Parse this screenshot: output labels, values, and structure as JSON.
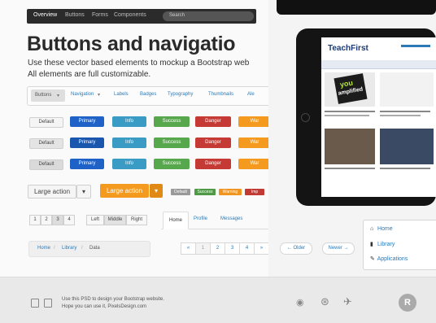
{
  "topnav": {
    "items": [
      "Overview",
      "Buttons",
      "Forms",
      "Components"
    ],
    "search_placeholder": "Search"
  },
  "page_title": "Buttons and navigatio",
  "description": [
    "Use these vector based elements to mockup a Bootstrap web",
    "All elements are full customizable."
  ],
  "tabnav": [
    "Buttons",
    "Navigation",
    "Labels",
    "Badges",
    "Typography",
    "Thumbnails",
    "Ale"
  ],
  "button_rows": [
    [
      "Default",
      "Primary",
      "Info",
      "Success",
      "Danger",
      "War"
    ],
    [
      "Default",
      "Primary",
      "Info",
      "Success",
      "Danger",
      "War"
    ],
    [
      "Default",
      "Primary",
      "Info",
      "Success",
      "Danger",
      "War"
    ]
  ],
  "large_actions": [
    "Large action",
    "Large action"
  ],
  "labels": [
    "Default",
    "Success",
    "Warning",
    "Imp"
  ],
  "pagination_small": [
    "1",
    "2",
    "3",
    "4"
  ],
  "segmented": [
    "Left",
    "Middle",
    "Right"
  ],
  "tabs": [
    "Home",
    "Profile",
    "Messages"
  ],
  "breadcrumb": [
    "Home",
    "/",
    "Library",
    "/",
    "Data"
  ],
  "pagination": [
    "«",
    "1",
    "2",
    "3",
    "4",
    "»"
  ],
  "pager": {
    "older": "← Older",
    "newer": "Newer →"
  },
  "dropdown": [
    {
      "icon": "home-icon",
      "label": "Home"
    },
    {
      "icon": "book-icon",
      "label": "Library"
    },
    {
      "icon": "pencil-icon",
      "label": "Applications"
    }
  ],
  "footer": {
    "line1": "Use this PSD to design your Bootstrap website.",
    "line2": "Hope you can use it, PixelsDesign.com"
  },
  "tablet": {
    "brand": "TeachFirst",
    "sticker": [
      "you",
      "amplified"
    ]
  }
}
